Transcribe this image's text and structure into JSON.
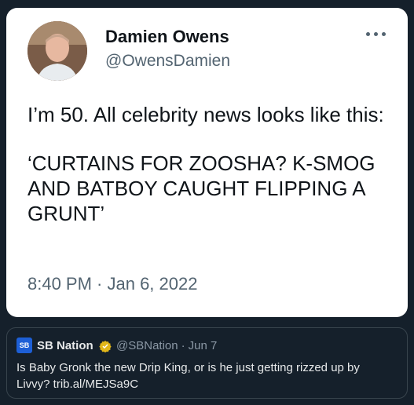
{
  "tweet": {
    "author_name": "Damien Owens",
    "author_handle": "@OwensDamien",
    "text_line1": "I’m 50. All celebrity news looks like this:",
    "text_line2": "‘CURTAINS FOR ZOOSHA? K-SMOG AND BATBOY CAUGHT FLIPPING A GRUNT’",
    "timestamp": "8:40 PM · Jan 6, 2022",
    "more_icon": "more-horizontal-icon"
  },
  "quoted_tweet": {
    "logo_text": "SB",
    "author_name": "SB Nation",
    "verified_icon": "gold-verified-badge-icon",
    "author_handle": "@SBNation",
    "separator": "·",
    "date": "Jun 7",
    "text": "Is Baby Gronk the new Drip King, or is he just getting rizzed up by Livvy? trib.al/MEJSa9C"
  },
  "colors": {
    "background": "#15202b",
    "card": "#ffffff",
    "primary_text": "#0f1419",
    "secondary_text": "#536471",
    "verified_gold": "#e2b719",
    "sbnation_blue": "#1d5fd6"
  }
}
